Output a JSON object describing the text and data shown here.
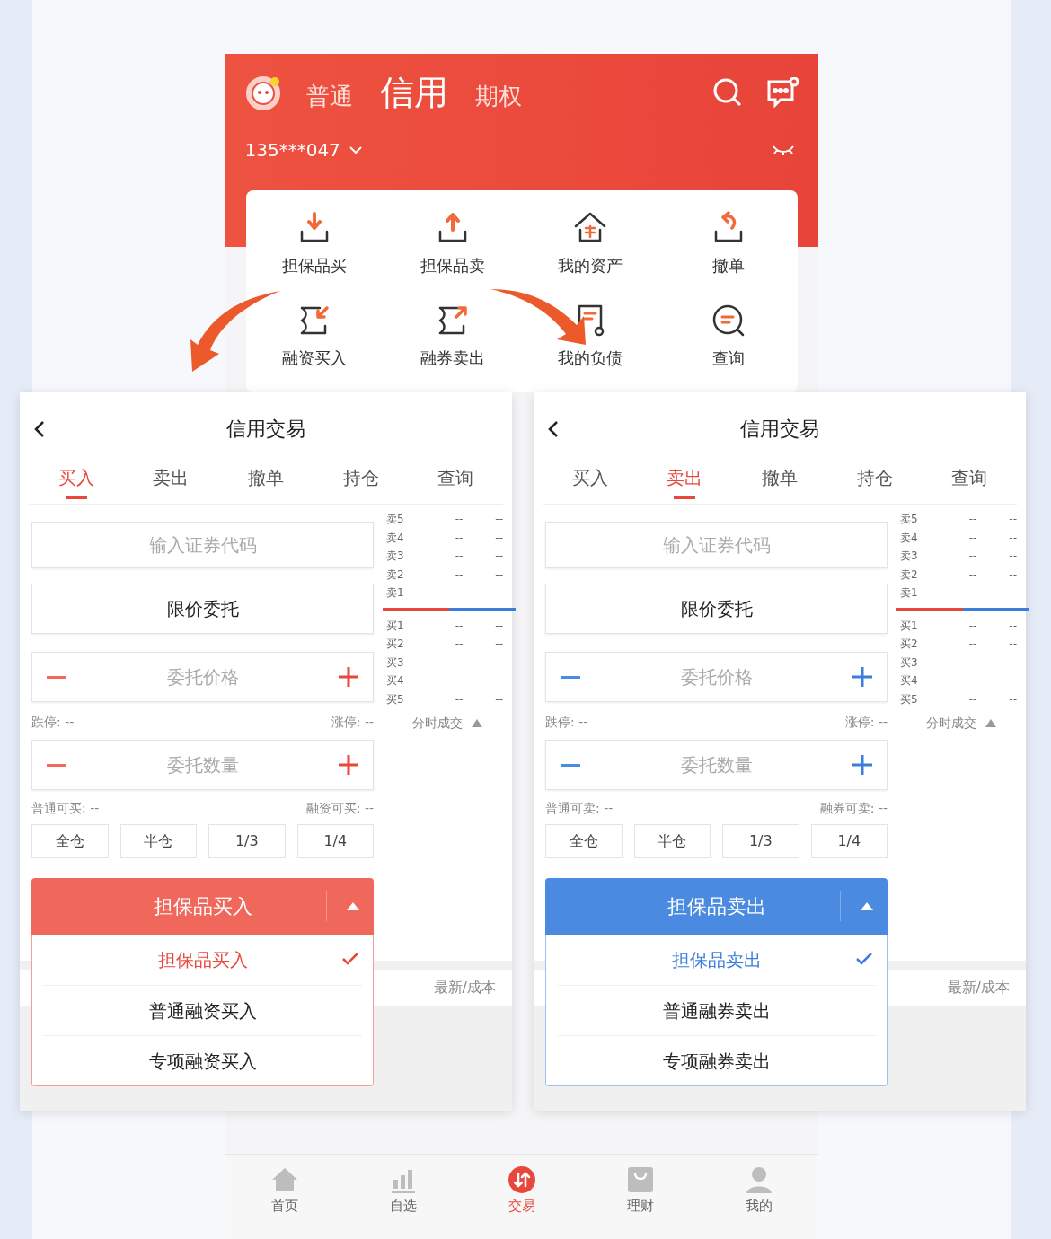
{
  "home": {
    "tabs": [
      {
        "label": "普通",
        "selected": false
      },
      {
        "label": "信用",
        "selected": true
      },
      {
        "label": "期权",
        "selected": false
      }
    ],
    "account": "135***047",
    "shortcuts": [
      {
        "label": "担保品买",
        "kind": "download"
      },
      {
        "label": "担保品卖",
        "kind": "upload"
      },
      {
        "label": "我的资产",
        "kind": "house"
      },
      {
        "label": "撤单",
        "kind": "undo"
      },
      {
        "label": "融资买入",
        "kind": "in"
      },
      {
        "label": "融券卖出",
        "kind": "out"
      },
      {
        "label": "我的负债",
        "kind": "doc"
      },
      {
        "label": "查询",
        "kind": "chat"
      }
    ],
    "nav": [
      {
        "label": "首页",
        "kind": "home",
        "selected": false
      },
      {
        "label": "自选",
        "kind": "bars",
        "selected": false
      },
      {
        "label": "交易",
        "kind": "trade",
        "selected": true
      },
      {
        "label": "理财",
        "kind": "bag",
        "selected": false
      },
      {
        "label": "我的",
        "kind": "user",
        "selected": false
      }
    ]
  },
  "panels": [
    {
      "kind": "buy",
      "title": "信用交易",
      "tabs": [
        {
          "label": "买入",
          "selected": true
        },
        {
          "label": "卖出",
          "selected": false
        },
        {
          "label": "撤单",
          "selected": false
        },
        {
          "label": "持仓",
          "selected": false
        },
        {
          "label": "查询",
          "selected": false
        }
      ],
      "code_placeholder": "输入证券代码",
      "order_type": "限价委托",
      "price_placeholder": "委托价格",
      "limit_down": "跌停: --",
      "limit_up": "涨停: --",
      "qty_placeholder": "委托数量",
      "avail_normal": "普通可买: --",
      "avail_credit": "融资可买: --",
      "ratios": [
        "全仓",
        "半仓",
        "1/3",
        "1/4"
      ],
      "book_sell": [
        {
          "label": "卖5",
          "price": "--",
          "volume": "--"
        },
        {
          "label": "卖4",
          "price": "--",
          "volume": "--"
        },
        {
          "label": "卖3",
          "price": "--",
          "volume": "--"
        },
        {
          "label": "卖2",
          "price": "--",
          "volume": "--"
        },
        {
          "label": "卖1",
          "price": "--",
          "volume": "--"
        }
      ],
      "book_buy": [
        {
          "label": "买1",
          "price": "--",
          "volume": "--"
        },
        {
          "label": "买2",
          "price": "--",
          "volume": "--"
        },
        {
          "label": "买3",
          "price": "--",
          "volume": "--"
        },
        {
          "label": "买4",
          "price": "--",
          "volume": "--"
        },
        {
          "label": "买5",
          "price": "--",
          "volume": "--"
        }
      ],
      "ticks_label": "分时成交",
      "submit": "担保品买入",
      "options": [
        {
          "label": "担保品买入",
          "selected": true
        },
        {
          "label": "普通融资买入",
          "selected": false
        },
        {
          "label": "专项融资买入",
          "selected": false
        }
      ],
      "footer": "最新/成本"
    },
    {
      "kind": "sell",
      "title": "信用交易",
      "tabs": [
        {
          "label": "买入",
          "selected": false
        },
        {
          "label": "卖出",
          "selected": true
        },
        {
          "label": "撤单",
          "selected": false
        },
        {
          "label": "持仓",
          "selected": false
        },
        {
          "label": "查询",
          "selected": false
        }
      ],
      "code_placeholder": "输入证券代码",
      "order_type": "限价委托",
      "price_placeholder": "委托价格",
      "limit_down": "跌停: --",
      "limit_up": "涨停: --",
      "qty_placeholder": "委托数量",
      "avail_normal": "普通可卖: --",
      "avail_credit": "融券可卖: --",
      "ratios": [
        "全仓",
        "半仓",
        "1/3",
        "1/4"
      ],
      "book_sell": [
        {
          "label": "卖5",
          "price": "--",
          "volume": "--"
        },
        {
          "label": "卖4",
          "price": "--",
          "volume": "--"
        },
        {
          "label": "卖3",
          "price": "--",
          "volume": "--"
        },
        {
          "label": "卖2",
          "price": "--",
          "volume": "--"
        },
        {
          "label": "卖1",
          "price": "--",
          "volume": "--"
        }
      ],
      "book_buy": [
        {
          "label": "买1",
          "price": "--",
          "volume": "--"
        },
        {
          "label": "买2",
          "price": "--",
          "volume": "--"
        },
        {
          "label": "买3",
          "price": "--",
          "volume": "--"
        },
        {
          "label": "买4",
          "price": "--",
          "volume": "--"
        },
        {
          "label": "买5",
          "price": "--",
          "volume": "--"
        }
      ],
      "ticks_label": "分时成交",
      "submit": "担保品卖出",
      "options": [
        {
          "label": "担保品卖出",
          "selected": true
        },
        {
          "label": "普通融券卖出",
          "selected": false
        },
        {
          "label": "专项融券卖出",
          "selected": false
        }
      ],
      "footer": "最新/成本"
    }
  ]
}
